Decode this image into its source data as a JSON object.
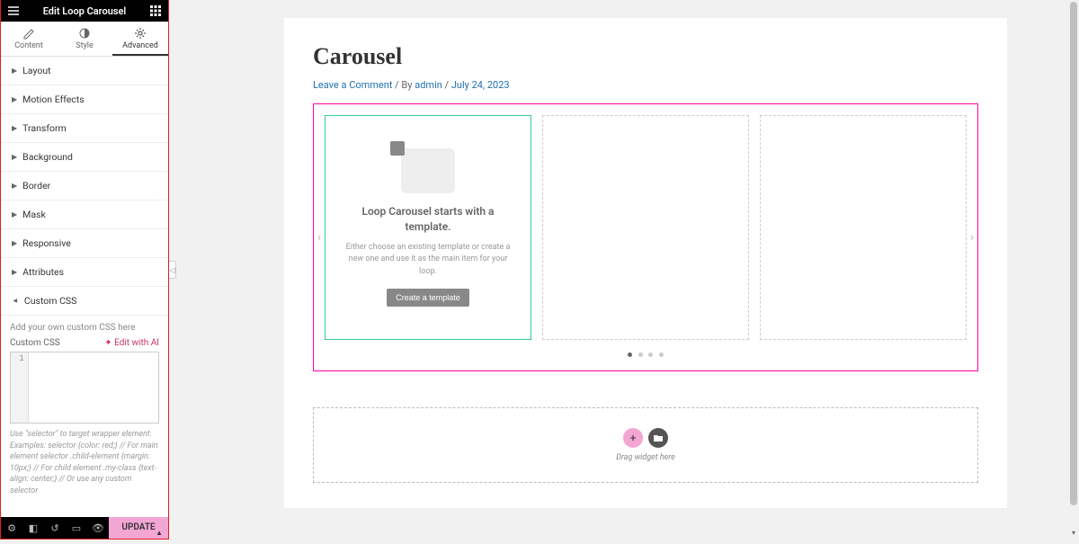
{
  "header": {
    "title": "Edit Loop Carousel"
  },
  "tabs": {
    "content": "Content",
    "style": "Style",
    "advanced": "Advanced"
  },
  "panels": {
    "layout": "Layout",
    "motion": "Motion Effects",
    "transform": "Transform",
    "background": "Background",
    "border": "Border",
    "mask": "Mask",
    "responsive": "Responsive",
    "attributes": "Attributes",
    "customcss": "Custom CSS"
  },
  "css": {
    "help": "Add your own custom CSS here",
    "label": "Custom CSS",
    "edit_ai": "Edit with AI",
    "line1": "1",
    "hint": "Use \"selector\" to target wrapper element. Examples:\nselector {color: red;} // For main element\nselector .child-element {margin: 10px;} // For child element\n.my-class {text-align: center;} // Or use any custom selector"
  },
  "footer": {
    "update": "UPDATE"
  },
  "page": {
    "title": "Carousel",
    "leave_comment": "Leave a Comment",
    "by": " / By ",
    "author": "admin",
    "sep2": " / ",
    "date": "July 24, 2023"
  },
  "slide": {
    "title": "Loop Carousel starts with a template.",
    "desc": "Either choose an existing template or create a new one and use it as the main item for your loop.",
    "create": "Create a template"
  },
  "drop": {
    "text": "Drag widget here"
  }
}
